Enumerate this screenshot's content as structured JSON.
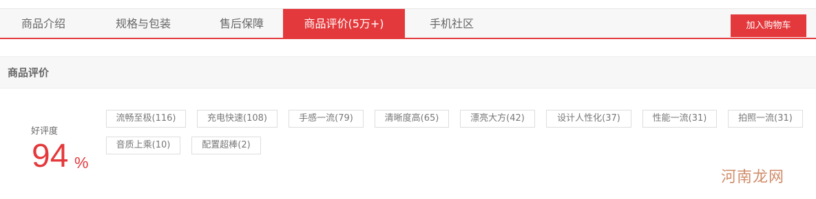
{
  "tabs": [
    {
      "label": "商品介绍",
      "active": false
    },
    {
      "label": "规格与包装",
      "active": false
    },
    {
      "label": "售后保障",
      "active": false
    },
    {
      "label": "商品评价(5万+)",
      "active": true
    },
    {
      "label": "手机社区",
      "active": false
    }
  ],
  "cart_button": "加入购物车",
  "section_title": "商品评价",
  "rating": {
    "label": "好评度",
    "value": "94",
    "unit": "%"
  },
  "tags": [
    "流畅至极(116)",
    "充电快速(108)",
    "手感一流(79)",
    "清晰度高(65)",
    "漂亮大方(42)",
    "设计人性化(37)",
    "性能一流(31)",
    "拍照一流(31)",
    "音质上乘(10)",
    "配置超棒(2)"
  ],
  "watermark": "河南龙网",
  "colors": {
    "accent": "#e4393c"
  }
}
